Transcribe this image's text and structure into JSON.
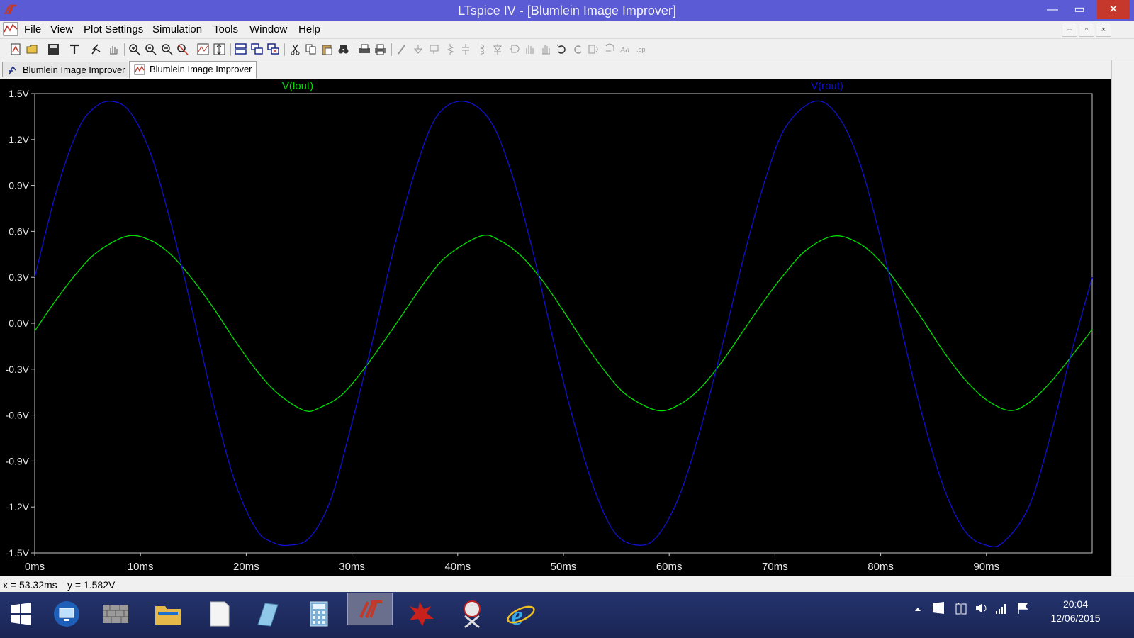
{
  "window": {
    "title": "LTspice IV - [Blumlein Image Improver]",
    "controls": {
      "minimize": "—",
      "maximize": "▭",
      "close": "✕"
    }
  },
  "menu": {
    "items": [
      "File",
      "View",
      "Plot Settings",
      "Simulation",
      "Tools",
      "Window",
      "Help"
    ],
    "mdi": {
      "minimize": "–",
      "restore": "▫",
      "close": "×"
    }
  },
  "toolbar": {
    "icons": [
      "new-schematic-icon",
      "open-icon",
      "save-icon",
      "control-panel-icon",
      "run-icon",
      "pan-hand-icon",
      "zoom-in-icon",
      "zoom-out-icon",
      "zoom-back-icon",
      "zoom-full-icon",
      "autorange-icon",
      "autorange-y-icon",
      "tile-horizontal-icon",
      "cascade-icon",
      "close-all-icon",
      "cut-icon",
      "copy-icon",
      "paste-icon",
      "find-icon",
      "print-icon",
      "print-setup-icon",
      "wire-icon",
      "ground-icon",
      "label-icon",
      "resistor-icon",
      "capacitor-icon",
      "inductor-icon",
      "diode-icon",
      "component-icon",
      "move-icon",
      "drag-icon",
      "undo-icon",
      "redo-icon",
      "rotate-icon",
      "mirror-icon",
      "text-icon",
      "spice-directive-icon"
    ]
  },
  "tabs": [
    {
      "label": "Blumlein Image Improver",
      "icon": "schematic-icon",
      "active": false
    },
    {
      "label": "Blumlein Image Improver",
      "icon": "waveform-icon",
      "active": true
    }
  ],
  "colors": {
    "plot_bg": "#000000",
    "lout": "#00e000",
    "rout": "#1010d0",
    "axis": "#c8c8c8",
    "tick_text": "#e8e8e8"
  },
  "chart_data": {
    "type": "line",
    "title": "",
    "xlabel": "",
    "ylabel": "",
    "x_unit": "ms",
    "y_unit": "V",
    "xlim": [
      0,
      100
    ],
    "ylim": [
      -1.5,
      1.5
    ],
    "x_ticks": [
      "0ms",
      "10ms",
      "20ms",
      "30ms",
      "40ms",
      "50ms",
      "60ms",
      "70ms",
      "80ms",
      "90ms"
    ],
    "y_ticks": [
      "1.5V",
      "1.2V",
      "0.9V",
      "0.6V",
      "0.3V",
      "0.0V",
      "-0.3V",
      "-0.6V",
      "-0.9V",
      "-1.2V",
      "-1.5V"
    ],
    "grid": false,
    "legend_position": "top",
    "series": [
      {
        "name": "V(lout)",
        "color": "#00e000",
        "x": [
          0,
          2,
          4,
          6,
          8.8,
          11,
          13,
          15,
          17,
          19,
          21,
          23,
          25.5,
          27,
          29,
          31,
          33,
          35,
          37,
          39,
          42.2,
          44,
          46,
          48,
          50,
          52,
          54,
          56,
          58.9,
          61,
          63,
          65,
          67,
          69,
          71,
          73,
          75.6,
          78,
          80,
          82,
          84,
          86,
          88,
          90,
          92.2,
          94,
          96,
          98,
          100
        ],
        "y": [
          -0.05,
          0.15,
          0.33,
          0.47,
          0.57,
          0.54,
          0.44,
          0.28,
          0.09,
          -0.12,
          -0.31,
          -0.46,
          -0.57,
          -0.55,
          -0.47,
          -0.31,
          -0.12,
          0.08,
          0.28,
          0.44,
          0.57,
          0.54,
          0.44,
          0.28,
          0.08,
          -0.13,
          -0.32,
          -0.47,
          -0.57,
          -0.53,
          -0.42,
          -0.25,
          -0.05,
          0.15,
          0.33,
          0.48,
          0.57,
          0.52,
          0.4,
          0.22,
          0.02,
          -0.19,
          -0.37,
          -0.5,
          -0.57,
          -0.52,
          -0.39,
          -0.22,
          -0.04
        ]
      },
      {
        "name": "V(rout)",
        "color": "#1010d0",
        "x": [
          0,
          2,
          4,
          5.5,
          7.2,
          9,
          11,
          13,
          15,
          17,
          19,
          21,
          22.5,
          24,
          26,
          28,
          30,
          32,
          34,
          36,
          38,
          40.5,
          43,
          45,
          47,
          49,
          51,
          53,
          55,
          57.3,
          59,
          61,
          63,
          65,
          67,
          69,
          71,
          73.8,
          76,
          78,
          80,
          82,
          84,
          86,
          88,
          90,
          91.6,
          94,
          96,
          98,
          100
        ],
        "y": [
          0.3,
          0.85,
          1.25,
          1.4,
          1.45,
          1.38,
          1.1,
          0.62,
          0.05,
          -0.55,
          -1.05,
          -1.35,
          -1.43,
          -1.45,
          -1.4,
          -1.15,
          -0.65,
          -0.1,
          0.5,
          1.0,
          1.35,
          1.45,
          1.33,
          1.0,
          0.5,
          -0.1,
          -0.65,
          -1.1,
          -1.38,
          -1.45,
          -1.38,
          -1.12,
          -0.68,
          -0.15,
          0.42,
          0.92,
          1.28,
          1.45,
          1.35,
          1.05,
          0.55,
          -0.05,
          -0.62,
          -1.08,
          -1.36,
          -1.45,
          -1.43,
          -1.2,
          -0.75,
          -0.2,
          0.3
        ]
      }
    ]
  },
  "status": {
    "cursor_x": "x = 53.32ms",
    "cursor_y": "y = 1.582V"
  },
  "taskbar": {
    "apps": [
      "start-icon",
      "remote-desktop-icon",
      "firewall-icon",
      "file-explorer-icon",
      "notepad-icon",
      "pen-icon",
      "calculator-icon",
      "ltspice-icon",
      "tux-paint-icon",
      "snipping-tool-icon",
      "internet-explorer-icon"
    ],
    "active_app": "ltspice-icon",
    "tray": [
      "show-hidden-icons-icon",
      "windows-flag-icon",
      "battery-icon",
      "volume-icon",
      "network-icon",
      "action-center-icon"
    ],
    "time": "20:04",
    "date": "12/06/2015"
  }
}
